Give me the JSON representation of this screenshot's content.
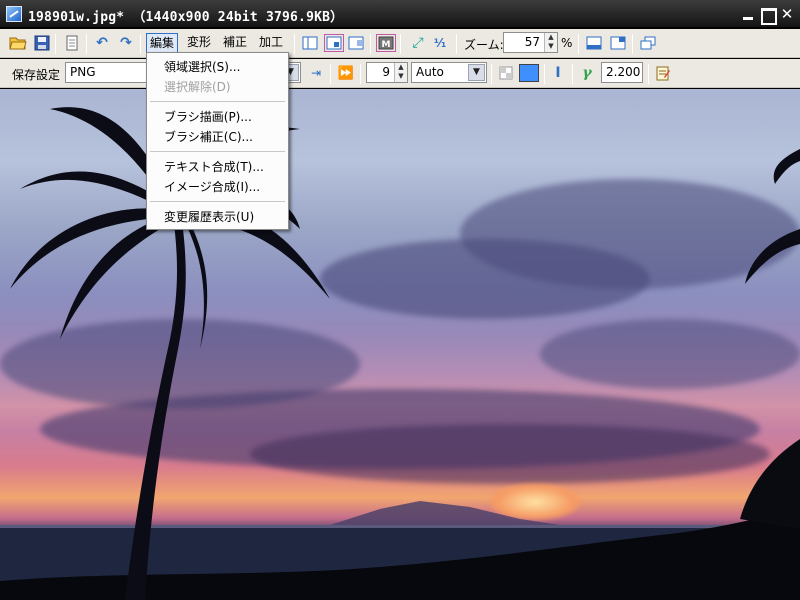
{
  "window": {
    "title": "198901w.jpg* （1440x900 24bit 3796.9KB）"
  },
  "toolbar": {
    "menus": [
      "編集",
      "変形",
      "補正",
      "加工"
    ],
    "zoom_label": "ズーム:",
    "zoom_value": "57",
    "zoom_unit": "%"
  },
  "toolbar2": {
    "save_label": "保存設定",
    "format_value": "PNG",
    "size_value": "9",
    "mode_value": "Auto",
    "color_swatch": "#3f8fff",
    "gamma_value": "2.200"
  },
  "edit_menu": {
    "items": [
      {
        "label": "領域選択(S)...",
        "disabled": false
      },
      {
        "label": "選択解除(D)",
        "disabled": true
      },
      {
        "label": "ブラシ描画(P)...",
        "disabled": false
      },
      {
        "label": "ブラシ補正(C)...",
        "disabled": false
      },
      {
        "label": "テキスト合成(T)...",
        "disabled": false
      },
      {
        "label": "イメージ合成(I)...",
        "disabled": false
      },
      {
        "label": "変更履歴表示(U)",
        "disabled": false
      }
    ]
  },
  "icons": {
    "open": "folder-open-icon",
    "save": "save-icon",
    "page": "page-icon",
    "undo": "undo-icon",
    "redo": "redo-icon"
  }
}
